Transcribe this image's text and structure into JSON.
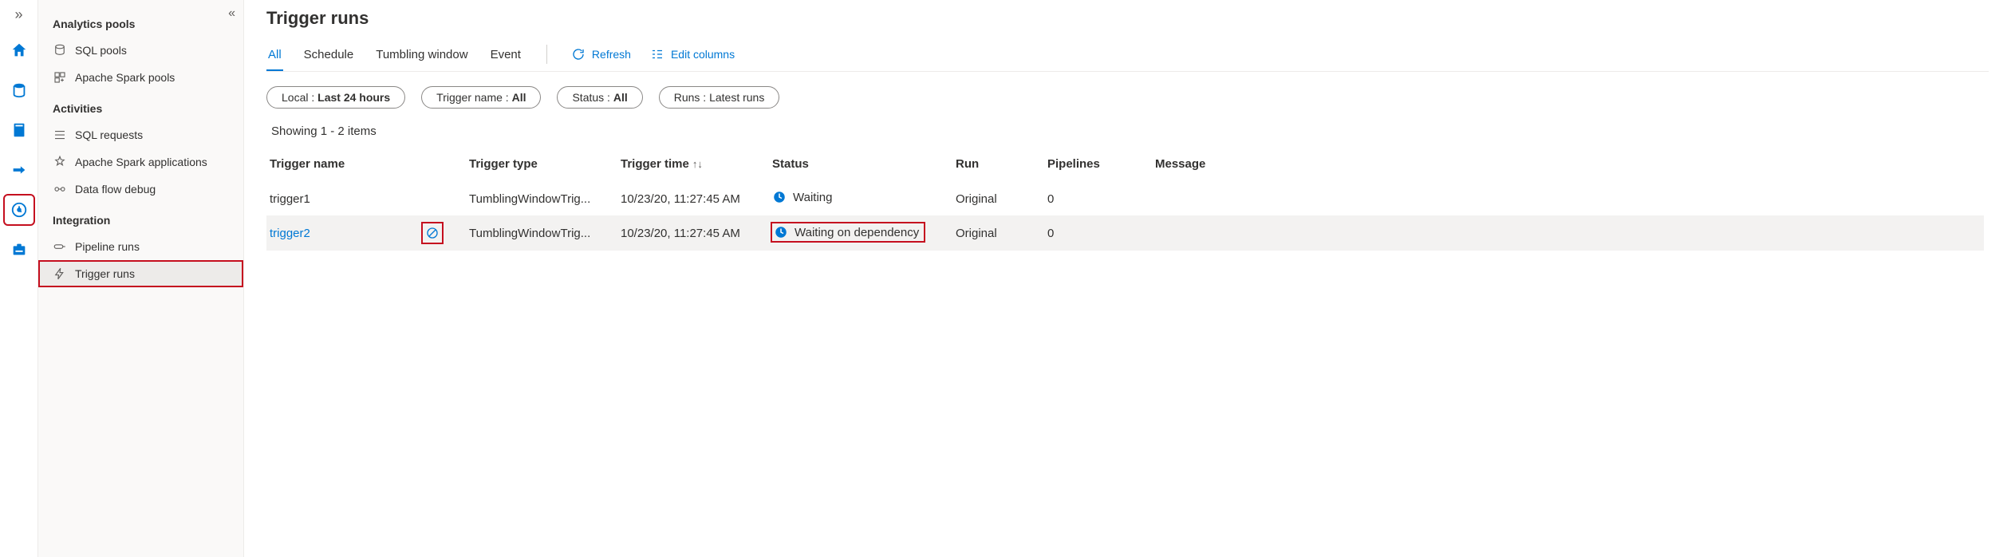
{
  "iconbar": {
    "expand": "»"
  },
  "sidebar": {
    "collapse": "«",
    "sections": [
      {
        "header": "Analytics pools",
        "items": [
          {
            "key": "sql-pools",
            "label": "SQL pools"
          },
          {
            "key": "spark-pools",
            "label": "Apache Spark pools"
          }
        ]
      },
      {
        "header": "Activities",
        "items": [
          {
            "key": "sql-requests",
            "label": "SQL requests"
          },
          {
            "key": "spark-apps",
            "label": "Apache Spark applications"
          },
          {
            "key": "data-flow-debug",
            "label": "Data flow debug"
          }
        ]
      },
      {
        "header": "Integration",
        "items": [
          {
            "key": "pipeline-runs",
            "label": "Pipeline runs"
          },
          {
            "key": "trigger-runs",
            "label": "Trigger runs",
            "selected": true
          }
        ]
      }
    ]
  },
  "page": {
    "title": "Trigger runs",
    "tabs": [
      {
        "key": "all",
        "label": "All",
        "active": true
      },
      {
        "key": "schedule",
        "label": "Schedule"
      },
      {
        "key": "tumbling",
        "label": "Tumbling window"
      },
      {
        "key": "event",
        "label": "Event"
      }
    ],
    "actions": {
      "refresh": "Refresh",
      "edit_columns": "Edit columns"
    },
    "filters": {
      "local_label": "Local :",
      "local_value": "Last 24 hours",
      "trigger_label": "Trigger name :",
      "trigger_value": "All",
      "status_label": "Status :",
      "status_value": "All",
      "runs_label": "Runs :",
      "runs_value": "Latest runs"
    },
    "showing": "Showing 1 - 2 items",
    "columns": {
      "name": "Trigger name",
      "type": "Trigger type",
      "time": "Trigger time",
      "status": "Status",
      "run": "Run",
      "pipelines": "Pipelines",
      "message": "Message"
    },
    "rows": [
      {
        "name": "trigger1",
        "type": "TumblingWindowTrig...",
        "time": "10/23/20, 11:27:45 AM",
        "status": "Waiting",
        "run": "Original",
        "pipelines": "0",
        "message": ""
      },
      {
        "name": "trigger2",
        "type": "TumblingWindowTrig...",
        "time": "10/23/20, 11:27:45 AM",
        "status": "Waiting on dependency",
        "run": "Original",
        "pipelines": "0",
        "message": "",
        "highlight": true,
        "link": true
      }
    ]
  }
}
